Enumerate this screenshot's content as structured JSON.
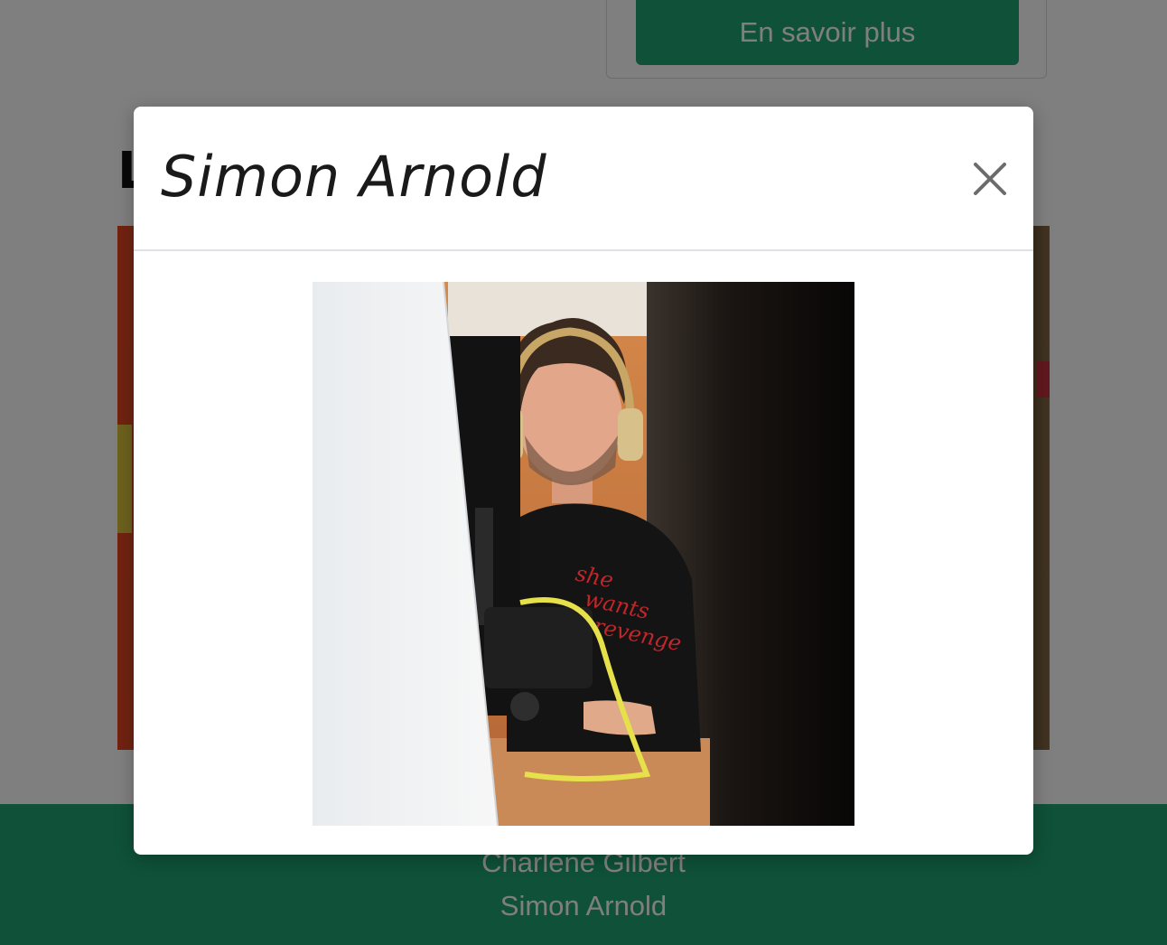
{
  "page": {
    "more_button_label": "En savoir plus",
    "section_heading": "L",
    "footer_names": [
      "Charlene Gilbert",
      "Simon Arnold"
    ]
  },
  "modal": {
    "title": "Simon Arnold",
    "close_icon": "close-icon",
    "photo": {
      "subject": "portrait-photo",
      "shirt_text": "she wants revenge"
    }
  },
  "colors": {
    "brand_green": "#1ea372",
    "backdrop": "rgba(0,0,0,0.5)",
    "modal_bg": "#ffffff"
  }
}
